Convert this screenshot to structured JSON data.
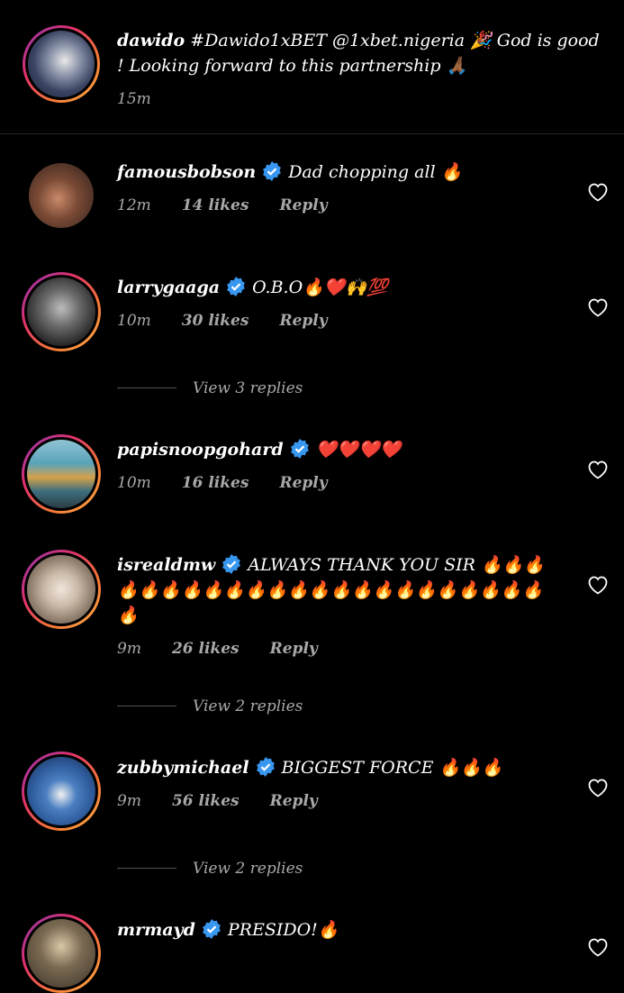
{
  "caption": {
    "user": "dawido",
    "text": "#Dawido1xBET @1xbet.nigeria 🎉  God is good ! Looking forward to this partnership 🙏🏾",
    "time": "15m"
  },
  "comments": [
    {
      "user": "famousbobson",
      "text": "Dad chopping all 🔥",
      "time": "12m",
      "likes": "14 likes",
      "reply": "Reply"
    },
    {
      "user": "larrygaaga",
      "text": "O.B.O🔥❤️🙌💯",
      "time": "10m",
      "likes": "30 likes",
      "reply": "Reply",
      "view_replies": "View 3 replies"
    },
    {
      "user": "papisnoopgohard",
      "text": "❤️❤️❤️❤️",
      "time": "10m",
      "likes": "16 likes",
      "reply": "Reply"
    },
    {
      "user": "isrealdmw",
      "text": "ALWAYS THANK YOU SIR 🔥🔥🔥🔥🔥🔥🔥🔥🔥🔥🔥🔥🔥🔥🔥🔥🔥🔥🔥🔥🔥🔥🔥🔥",
      "time": "9m",
      "likes": "26 likes",
      "reply": "Reply",
      "view_replies": "View 2 replies"
    },
    {
      "user": "zubbymichael",
      "text": "BIGGEST FORCE 🔥🔥🔥",
      "time": "9m",
      "likes": "56 likes",
      "reply": "Reply",
      "view_replies": "View 2 replies"
    },
    {
      "user": "mrmayd",
      "text": "PRESIDO!🔥"
    }
  ],
  "colors": {
    "verified": "#3897f0",
    "muted": "#a8a8a8"
  }
}
